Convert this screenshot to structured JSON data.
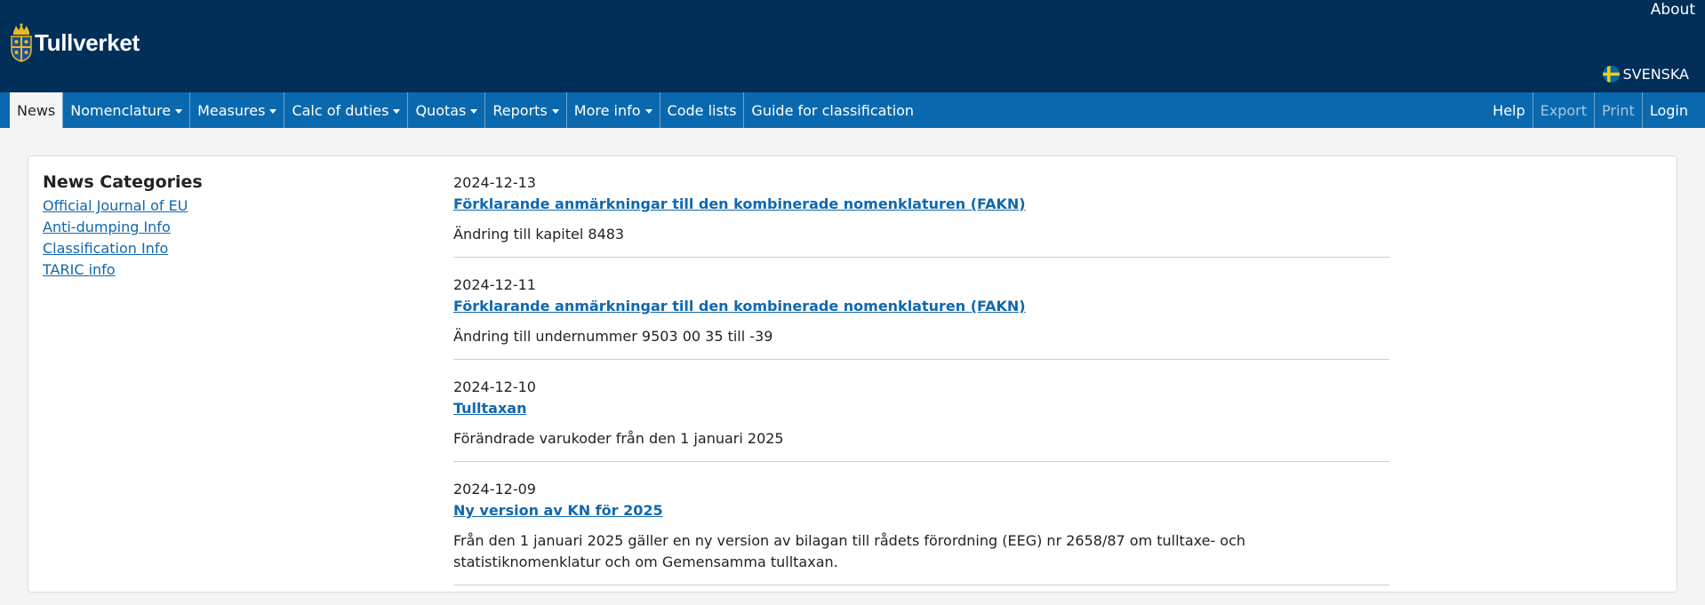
{
  "header": {
    "brand": "Tullverket",
    "about": "About",
    "language": "SVENSKA"
  },
  "nav": {
    "left": [
      {
        "label": "News",
        "active": true,
        "dropdown": false
      },
      {
        "label": "Nomenclature",
        "dropdown": true
      },
      {
        "label": "Measures",
        "dropdown": true
      },
      {
        "label": "Calc of duties",
        "dropdown": true
      },
      {
        "label": "Quotas",
        "dropdown": true
      },
      {
        "label": "Reports",
        "dropdown": true
      },
      {
        "label": "More info",
        "dropdown": true
      },
      {
        "label": "Code lists",
        "dropdown": false
      },
      {
        "label": "Guide for classification",
        "dropdown": false
      }
    ],
    "right": [
      {
        "label": "Help",
        "disabled": false
      },
      {
        "label": "Export",
        "disabled": true
      },
      {
        "label": "Print",
        "disabled": true
      },
      {
        "label": "Login",
        "disabled": false
      }
    ]
  },
  "sidebar": {
    "title": "News Categories",
    "items": [
      "Official Journal of EU",
      "Anti-dumping Info",
      "Classification Info",
      "TARIC info"
    ]
  },
  "news": [
    {
      "date": "2024-12-13",
      "title": "Förklarande anmärkningar till den kombinerade nomenklaturen (FAKN)",
      "desc": "Ändring till kapitel 8483"
    },
    {
      "date": "2024-12-11",
      "title": "Förklarande anmärkningar till den kombinerade nomenklaturen (FAKN)",
      "desc": "Ändring till undernummer 9503 00 35 till -39"
    },
    {
      "date": "2024-12-10",
      "title": "Tulltaxan",
      "desc": "Förändrade varukoder från den 1 januari 2025"
    },
    {
      "date": "2024-12-09",
      "title": "Ny version av KN för 2025",
      "desc": "Från den 1 januari 2025 gäller en ny version av bilagan till rådets förordning (EEG) nr 2658/87 om tulltaxe- och statistiknomenklatur och om Gemensamma tulltaxan."
    }
  ],
  "colors": {
    "header_bg": "#002f5a",
    "nav_bg": "#0a69ae",
    "link": "#1168ad"
  }
}
